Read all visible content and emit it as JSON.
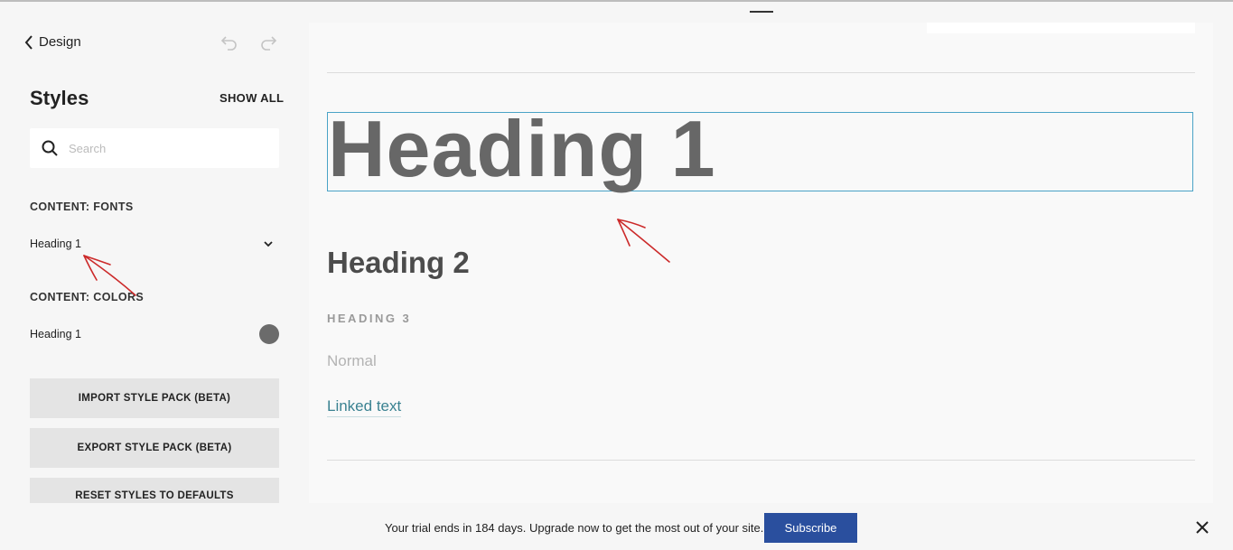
{
  "sidebar": {
    "back_label": "Design",
    "title": "Styles",
    "show_all_label": "SHOW ALL",
    "search_placeholder": "Search",
    "fonts_section": {
      "label": "CONTENT: FONTS",
      "item_label": "Heading 1"
    },
    "colors_section": {
      "label": "CONTENT: COLORS",
      "item_label": "Heading 1",
      "swatch_color": "#6b6b6b"
    },
    "buttons": {
      "import": "IMPORT STYLE PACK (BETA)",
      "export": "EXPORT STYLE PACK (BETA)",
      "reset": "RESET STYLES TO DEFAULTS"
    }
  },
  "preview": {
    "heading1": "Heading 1",
    "heading2": "Heading 2",
    "heading3": "HEADING 3",
    "normal": "Normal",
    "link": "Linked text",
    "selection_color": "#4aa3c7",
    "link_color": "#3a8291"
  },
  "banner": {
    "message": "Your trial ends in 184 days. Upgrade now to get the most out of your site.",
    "subscribe_label": "Subscribe",
    "subscribe_color": "#2a4f9e"
  },
  "icons": [
    "chevron-left-icon",
    "undo-icon",
    "redo-icon",
    "search-icon",
    "chevron-down-icon",
    "close-icon"
  ]
}
